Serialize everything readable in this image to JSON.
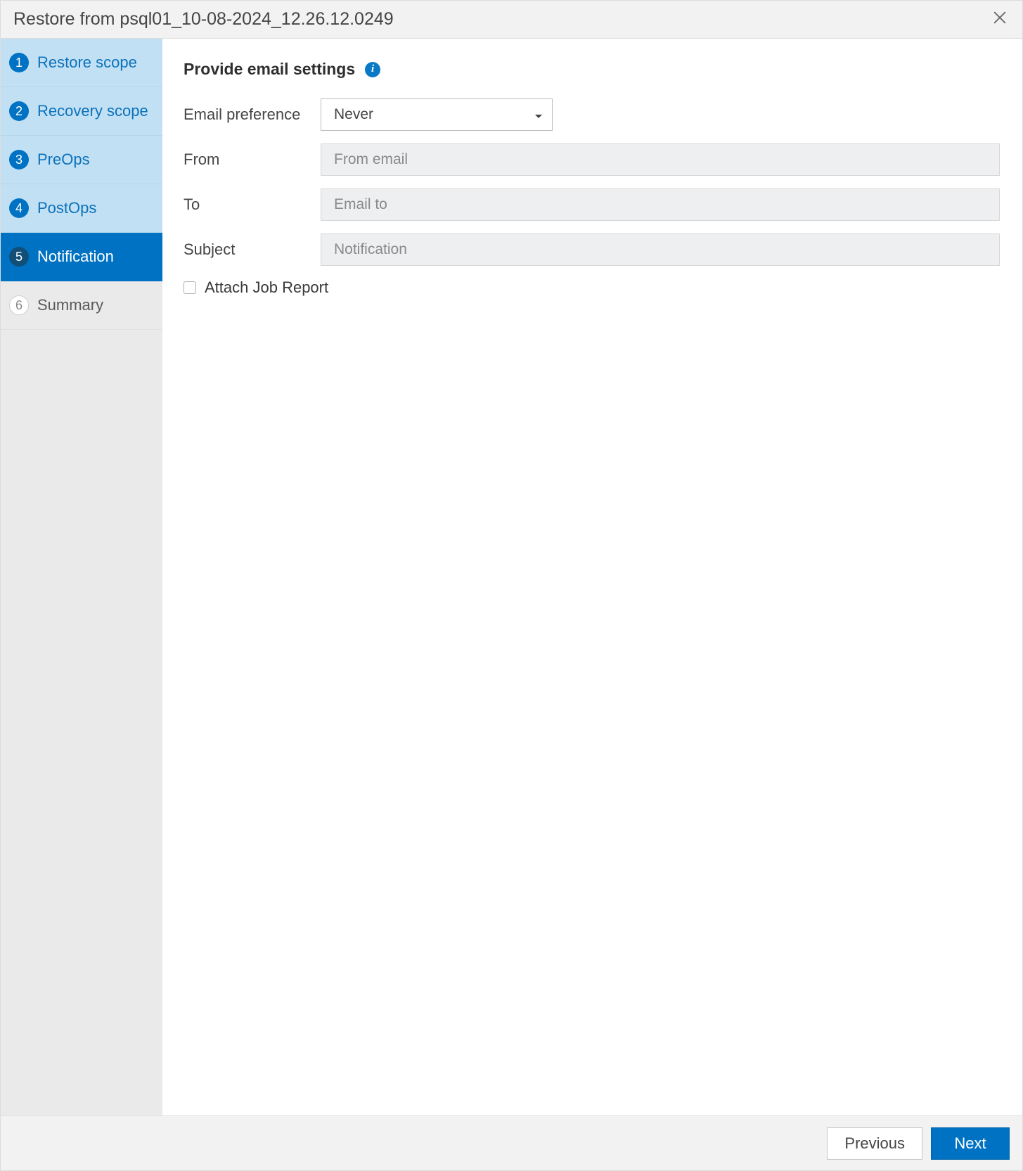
{
  "header": {
    "title": "Restore from psql01_10-08-2024_12.26.12.0249"
  },
  "sidebar": {
    "steps": [
      {
        "num": "1",
        "label": "Restore scope",
        "state": "completed"
      },
      {
        "num": "2",
        "label": "Recovery scope",
        "state": "completed"
      },
      {
        "num": "3",
        "label": "PreOps",
        "state": "completed"
      },
      {
        "num": "4",
        "label": "PostOps",
        "state": "completed"
      },
      {
        "num": "5",
        "label": "Notification",
        "state": "active"
      },
      {
        "num": "6",
        "label": "Summary",
        "state": "upcoming"
      }
    ]
  },
  "main": {
    "heading": "Provide email settings",
    "info_icon": "i",
    "fields": {
      "email_preference": {
        "label": "Email preference",
        "value": "Never"
      },
      "from": {
        "label": "From",
        "placeholder": "From email",
        "value": ""
      },
      "to": {
        "label": "To",
        "placeholder": "Email to",
        "value": ""
      },
      "subject": {
        "label": "Subject",
        "placeholder": "Notification",
        "value": ""
      }
    },
    "attach_job_report": {
      "label": "Attach Job Report",
      "checked": false
    }
  },
  "footer": {
    "previous": "Previous",
    "next": "Next"
  }
}
